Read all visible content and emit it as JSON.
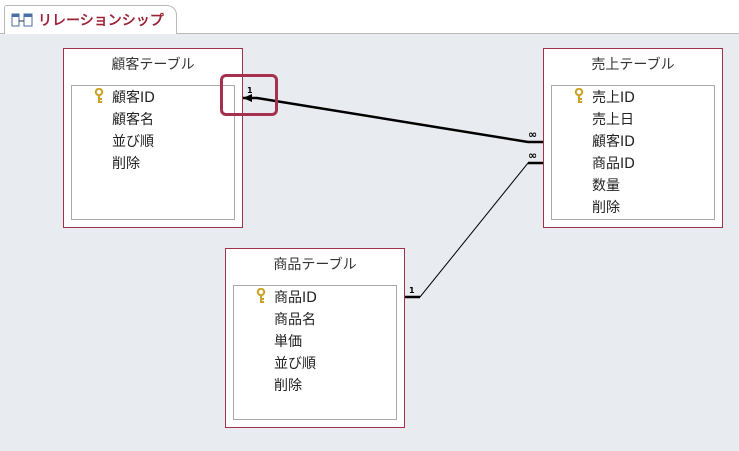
{
  "tab": {
    "label": "リレーションシップ"
  },
  "tables": {
    "customer": {
      "title": "顧客テーブル",
      "fields": [
        {
          "name": "顧客ID",
          "key": true
        },
        {
          "name": "顧客名",
          "key": false
        },
        {
          "name": "並び順",
          "key": false
        },
        {
          "name": "削除",
          "key": false
        }
      ]
    },
    "sales": {
      "title": "売上テーブル",
      "fields": [
        {
          "name": "売上ID",
          "key": true
        },
        {
          "name": "売上日",
          "key": false
        },
        {
          "name": "顧客ID",
          "key": false
        },
        {
          "name": "商品ID",
          "key": false
        },
        {
          "name": "数量",
          "key": false
        },
        {
          "name": "削除",
          "key": false
        }
      ]
    },
    "product": {
      "title": "商品テーブル",
      "fields": [
        {
          "name": "商品ID",
          "key": true
        },
        {
          "name": "商品名",
          "key": false
        },
        {
          "name": "単価",
          "key": false
        },
        {
          "name": "並び順",
          "key": false
        },
        {
          "name": "削除",
          "key": false
        }
      ]
    }
  },
  "relationships": {
    "customer_sales": {
      "one_label": "1",
      "many_label": "∞"
    },
    "product_sales": {
      "one_label": "1",
      "many_label": "∞"
    }
  },
  "colors": {
    "accent": "#9b2335",
    "table_border": "#a0324a",
    "canvas": "#e8ebef",
    "highlight": "#a6314f",
    "key": "#c9a227"
  },
  "icons": {
    "tab": "relationship-icon",
    "primary_key": "key-icon"
  }
}
